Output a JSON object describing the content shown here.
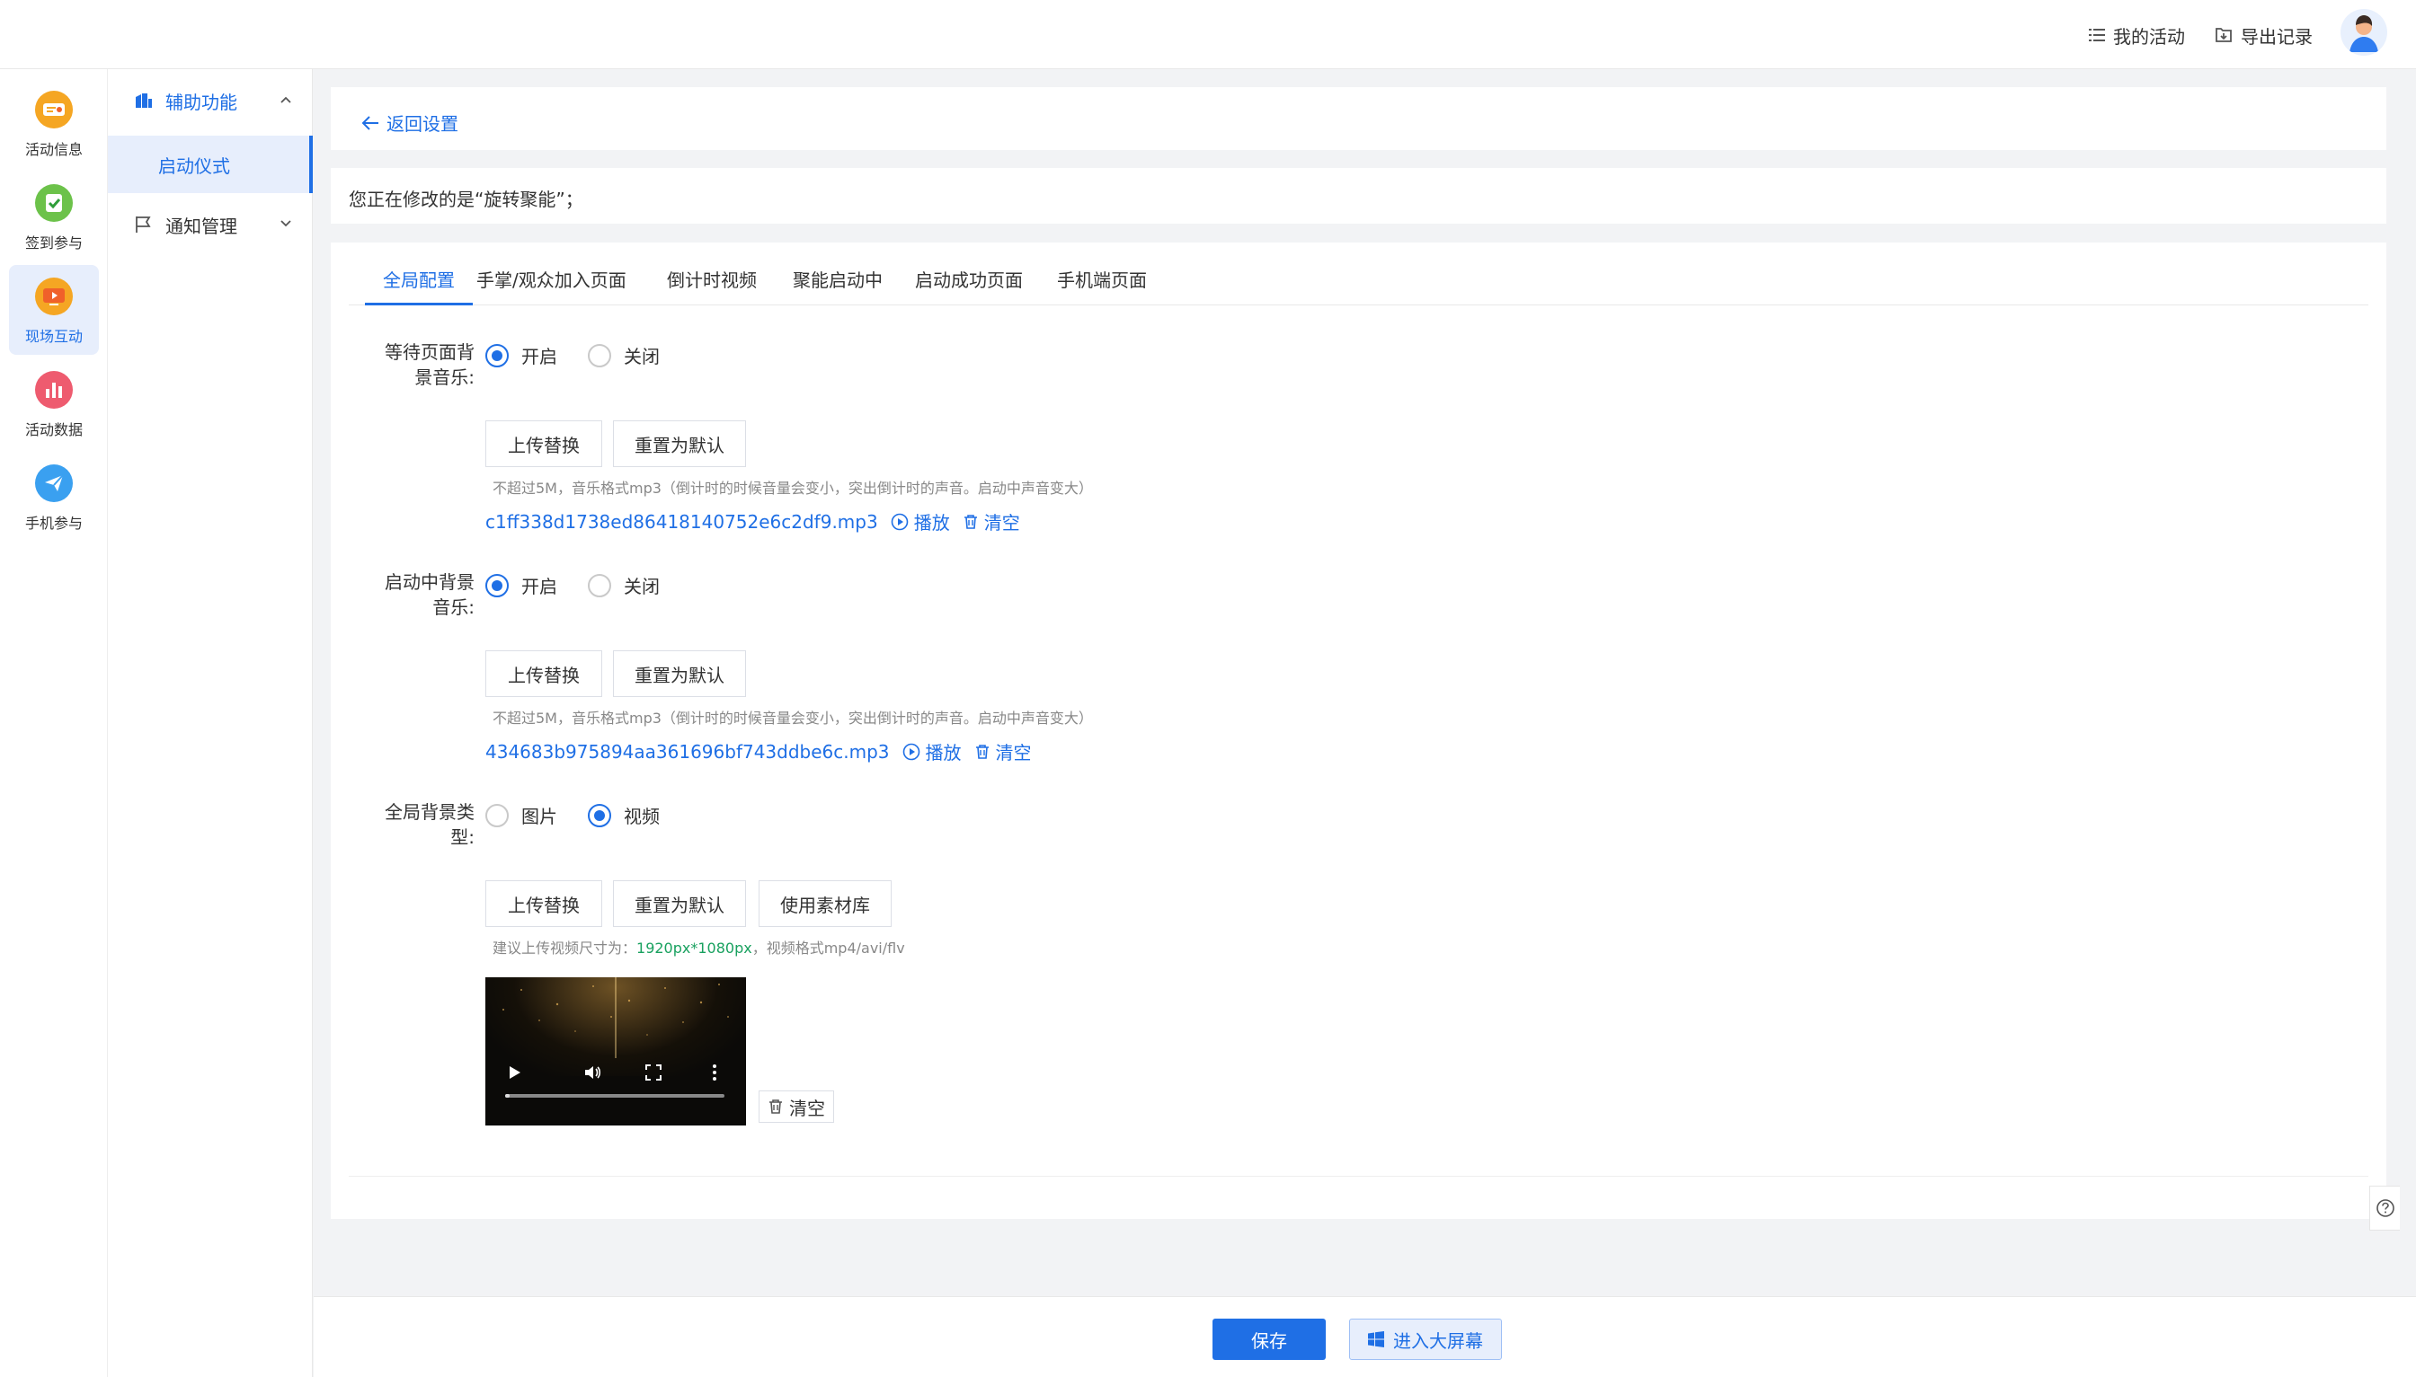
{
  "header": {
    "my_activity": "我的活动",
    "export_records": "导出记录",
    "icons": {
      "my_activity": "list-icon",
      "export": "export-icon",
      "avatar": "user-avatar"
    }
  },
  "rail": {
    "items": [
      {
        "label": "活动信息",
        "icon": "ticket-icon",
        "color": "#f5a623"
      },
      {
        "label": "签到参与",
        "icon": "check-badge-icon",
        "color": "#6cc24a"
      },
      {
        "label": "现场互动",
        "icon": "play-screen-icon",
        "color": "#f5a623",
        "active": true
      },
      {
        "label": "活动数据",
        "icon": "bar-chart-icon",
        "color": "#ee5b6f"
      },
      {
        "label": "手机参与",
        "icon": "paper-plane-icon",
        "color": "#3aa0f0"
      }
    ]
  },
  "subnav": {
    "group1": {
      "label": "辅助功能",
      "icon": "building-icon",
      "expanded": true
    },
    "group1_items": [
      "启动仪式"
    ],
    "group2": {
      "label": "通知管理",
      "icon": "flag-icon",
      "expanded": false
    }
  },
  "page": {
    "back_label": "返回设置",
    "notice": "您正在修改的是“旋转聚能”；"
  },
  "tabs": [
    {
      "label": "全局配置",
      "active": true
    },
    {
      "label": "手掌/观众加入页面"
    },
    {
      "label": "倒计时视频"
    },
    {
      "label": "聚能启动中"
    },
    {
      "label": "启动成功页面"
    },
    {
      "label": "手机端页面"
    }
  ],
  "form": {
    "wait_music": {
      "label_line1": "等待页面背",
      "label_line2": "景音乐:",
      "on": "开启",
      "off": "关闭",
      "selected": "开启",
      "upload": "上传替换",
      "reset": "重置为默认",
      "hint": "不超过5M，音乐格式mp3（倒计时的时候音量会变小，突出倒计时的声音。启动中声音变大）",
      "file": "c1ff338d1738ed86418140752e6c2df9.mp3",
      "play": "播放",
      "clear": "清空"
    },
    "launch_music": {
      "label_line1": "启动中背景",
      "label_line2": "音乐:",
      "on": "开启",
      "off": "关闭",
      "selected": "开启",
      "upload": "上传替换",
      "reset": "重置为默认",
      "hint": "不超过5M，音乐格式mp3（倒计时的时候音量会变小，突出倒计时的声音。启动中声音变大）",
      "file": "434683b975894aa361696bf743ddbe6c.mp3",
      "play": "播放",
      "clear": "清空"
    },
    "bg_type": {
      "label_line1": "全局背景类",
      "label_line2": "型:",
      "image": "图片",
      "video": "视频",
      "selected": "视频",
      "upload": "上传替换",
      "reset": "重置为默认",
      "library": "使用素材库",
      "hint_prefix": "建议上传视频尺寸为：",
      "hint_size": "1920px*1080px",
      "hint_suffix": "，视频格式mp4/avi/flv",
      "clear": "清空",
      "video_progress": 0.02
    }
  },
  "footer": {
    "save": "保存",
    "enter_screen": "进入大屏幕"
  },
  "colors": {
    "primary": "#1f6fe5",
    "primary_light": "#e7eefc",
    "hint_green": "#19a15f"
  }
}
